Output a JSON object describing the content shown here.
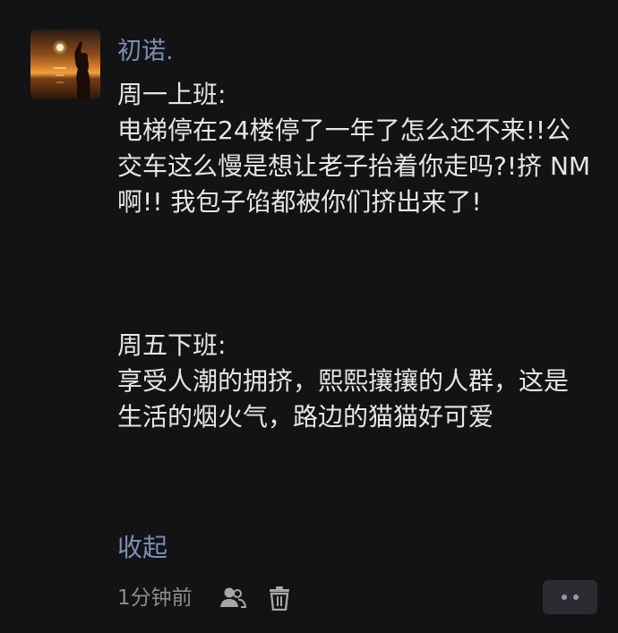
{
  "post": {
    "username": "初诺.",
    "text": "周一上班:\n电梯停在24楼停了一年了怎么还不来!!公交车这么慢是想让老子抬着你走吗?!挤 NM啊!! 我包子馅都被你们挤出来了!\n\n\n\n周五下班:\n享受人潮的拥挤，熙熙攘攘的人群，这是生活的烟火气，路边的猫猫好可爱",
    "collapse_label": "收起",
    "timestamp": "1分钟前"
  },
  "icons": {
    "avatar": "sunset-photo-avatar",
    "visibility": "people-icon",
    "delete": "trash-icon",
    "more": "more-dots-icon"
  },
  "colors": {
    "background": "#131315",
    "text": "#e6e6e8",
    "link": "#7c8fb2",
    "muted": "#8c8c90",
    "more_button_bg": "#2c2c30"
  }
}
